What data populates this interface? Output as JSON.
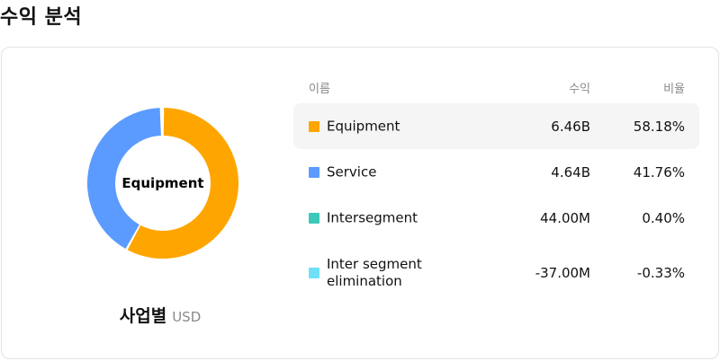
{
  "title": "수익 분석",
  "chart": {
    "center_label": "Equipment",
    "caption": "사업별",
    "unit": "USD"
  },
  "table": {
    "headers": {
      "name": "이름",
      "revenue": "수익",
      "ratio": "비율"
    },
    "rows": [
      {
        "name": "Equipment",
        "revenue": "6.46B",
        "ratio": "58.18%",
        "color": "#FFA500",
        "selected": true
      },
      {
        "name": "Service",
        "revenue": "4.64B",
        "ratio": "41.76%",
        "color": "#5B9BFF",
        "selected": false
      },
      {
        "name": "Intersegment",
        "revenue": "44.00M",
        "ratio": "0.40%",
        "color": "#3CC9B9",
        "selected": false
      },
      {
        "name": "Inter segment elimination",
        "revenue": "-37.00M",
        "ratio": "-0.33%",
        "color": "#6FE0F5",
        "selected": false
      }
    ]
  },
  "chart_data": {
    "type": "pie",
    "categories": [
      "Equipment",
      "Service",
      "Intersegment",
      "Inter segment elimination"
    ],
    "values": [
      58.18,
      41.76,
      0.4,
      -0.33
    ],
    "colors": [
      "#FFA500",
      "#5B9BFF",
      "#3CC9B9",
      "#6FE0F5"
    ],
    "highlighted": "Equipment"
  }
}
